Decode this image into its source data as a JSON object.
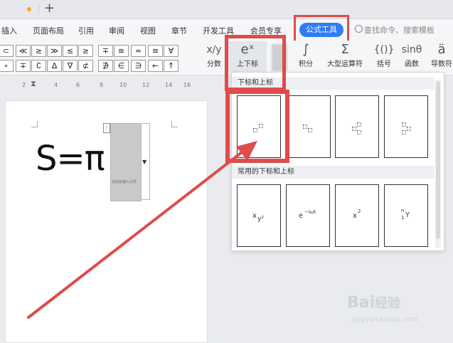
{
  "menubar": {
    "items": [
      "插入",
      "页面布局",
      "引用",
      "审阅",
      "视图",
      "章节",
      "开发工具",
      "会员专享"
    ],
    "active_tab": "公式工具",
    "search_placeholder": "查找命令、搜索模板"
  },
  "ribbon": {
    "symbols_row1": [
      "⊂",
      "≪",
      "≥",
      "≫",
      "≤",
      "≥",
      "∓",
      "≅",
      "≈",
      "≡",
      "∀"
    ],
    "symbols_row2": [
      "∘",
      "∓",
      "∁",
      "∆",
      "∇",
      "⊄",
      "∌",
      "∈",
      "∋",
      "←",
      "↑"
    ],
    "buttons": [
      {
        "label": "分数",
        "icon": "x/y"
      },
      {
        "label": "上下标",
        "icon": "eˣ"
      },
      {
        "label": "积分",
        "icon": "∫"
      },
      {
        "label": "大型运算符",
        "icon": "Σ"
      },
      {
        "label": "括号",
        "icon": "{()}"
      },
      {
        "label": "函数",
        "icon": "sinθ"
      },
      {
        "label": "导数符",
        "icon": "ä"
      }
    ]
  },
  "ruler": {
    "numbers": [
      "2",
      "4",
      "6",
      "8",
      "10",
      "12",
      "14",
      "16"
    ]
  },
  "document": {
    "formula": "S=π",
    "placeholder_hint": "在此处输入公式"
  },
  "panel": {
    "section1_title": "下标和上标",
    "section2_title": "常用的下标和上标",
    "common": [
      {
        "base": "x",
        "sup": "y²"
      },
      {
        "base": "e",
        "sup": "−iωt"
      },
      {
        "base": "x",
        "sup": "2"
      },
      {
        "base": "Y",
        "sup": "n",
        "sub": "1"
      }
    ]
  },
  "watermark": {
    "logo": "Bai",
    "logo2": "经验",
    "url": "jingyan.baidu.com"
  },
  "colors": {
    "accent": "#2f7cf6",
    "highlight": "#e04b4b"
  }
}
